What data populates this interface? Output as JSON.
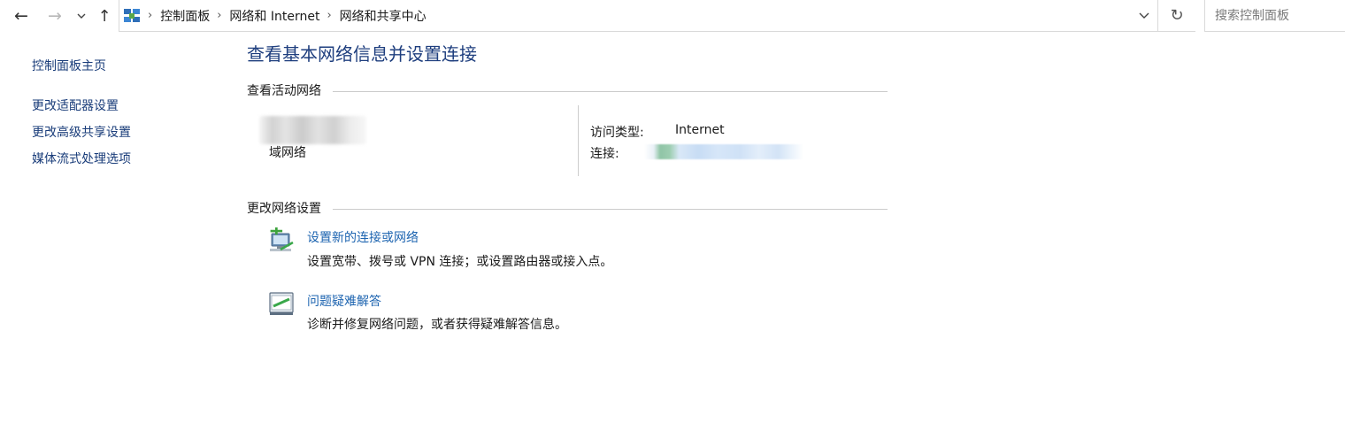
{
  "address_bar": {
    "breadcrumbs": [
      "控制面板",
      "网络和 Internet",
      "网络和共享中心"
    ],
    "search_placeholder": "搜索控制面板"
  },
  "icons": {
    "back": "arrow-left-icon",
    "forward": "arrow-right-icon",
    "recent": "chevron-down-icon",
    "up": "arrow-up-icon",
    "location": "network-center-icon",
    "refresh": "refresh-icon",
    "setup_connection": "network-setup-icon",
    "troubleshoot": "troubleshoot-icon"
  },
  "sidebar": {
    "items": [
      {
        "label": "控制面板主页"
      },
      {
        "label": "更改适配器设置"
      },
      {
        "label": "更改高级共享设置"
      },
      {
        "label": "媒体流式处理选项"
      }
    ]
  },
  "main": {
    "title": "查看基本网络信息并设置连接",
    "active_networks": {
      "heading": "查看活动网络",
      "network_type": "域网络",
      "access_type_label": "访问类型:",
      "access_type_value": "Internet",
      "connection_label": "连接:"
    },
    "change_settings": {
      "heading": "更改网络设置",
      "tasks": [
        {
          "link": "设置新的连接或网络",
          "description": "设置宽带、拨号或 VPN 连接；或设置路由器或接入点。"
        },
        {
          "link": "问题疑难解答",
          "description": "诊断并修复网络问题，或者获得疑难解答信息。"
        }
      ]
    }
  },
  "colors": {
    "title_blue": "#1e3e7e",
    "link_blue": "#1d64b0",
    "sidebar_link": "#1a3d7a",
    "divider": "#cccccc"
  }
}
